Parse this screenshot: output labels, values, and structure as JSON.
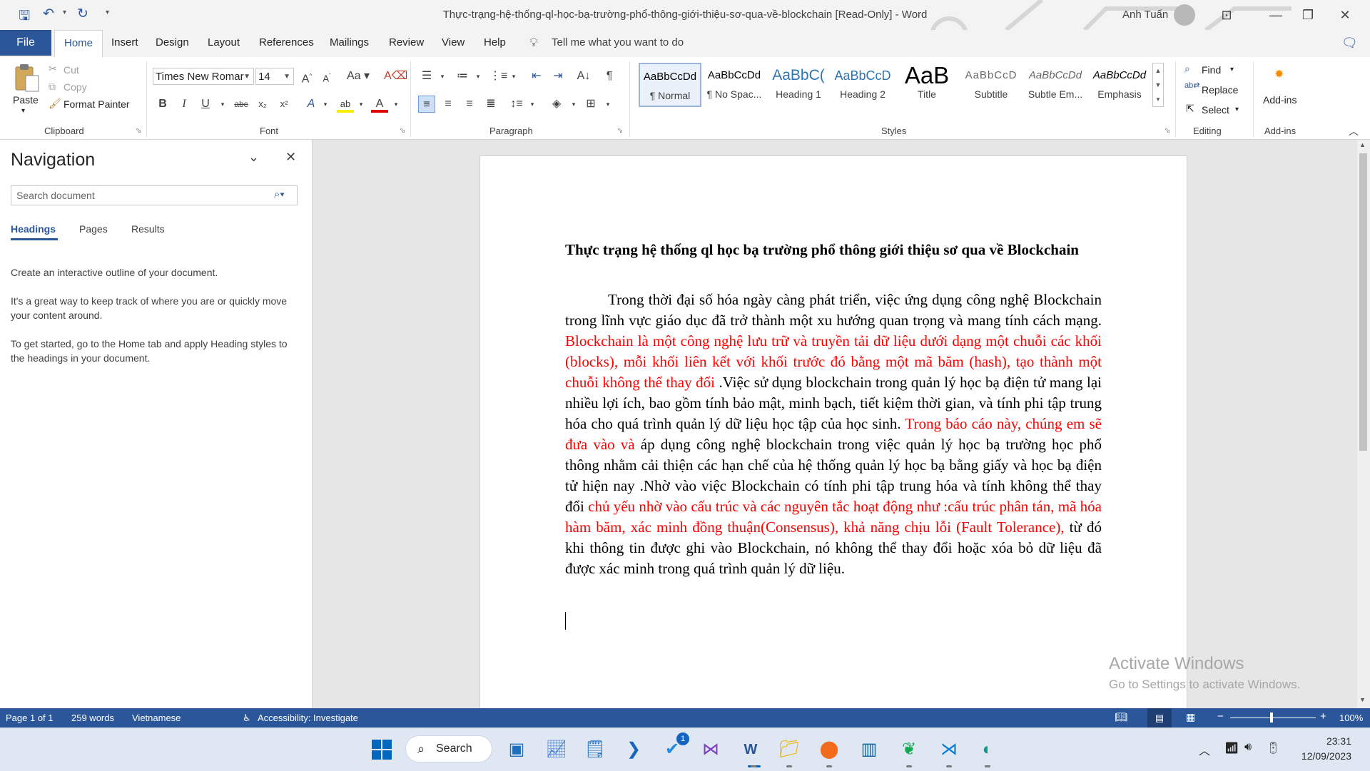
{
  "window": {
    "title": "Thực-trạng-hệ-thống-ql-học-bạ-trường-phổ-thông-giới-thiệu-sơ-qua-về-blockchain [Read-Only]  -  Word",
    "user": "Anh Tuấn"
  },
  "tabs": [
    "File",
    "Home",
    "Insert",
    "Design",
    "Layout",
    "References",
    "Mailings",
    "Review",
    "View",
    "Help"
  ],
  "tell_me": "Tell me what you want to do",
  "ribbon": {
    "clipboard": {
      "paste": "Paste",
      "cut": "Cut",
      "copy": "Copy",
      "format_painter": "Format Painter",
      "label": "Clipboard"
    },
    "font": {
      "name": "Times New Romar",
      "size": "14",
      "label": "Font"
    },
    "paragraph": {
      "label": "Paragraph"
    },
    "styles": {
      "label": "Styles",
      "items": [
        {
          "preview": "AaBbCcDd",
          "name": "¶ Normal"
        },
        {
          "preview": "AaBbCcDd",
          "name": "¶ No Spac..."
        },
        {
          "preview": "AaBbC(",
          "name": "Heading 1"
        },
        {
          "preview": "AaBbCcD",
          "name": "Heading 2"
        },
        {
          "preview": "AaB",
          "name": "Title"
        },
        {
          "preview": "AaBbCcD",
          "name": "Subtitle"
        },
        {
          "preview": "AaBbCcDd",
          "name": "Subtle Em..."
        },
        {
          "preview": "AaBbCcDd",
          "name": "Emphasis"
        }
      ]
    },
    "editing": {
      "find": "Find",
      "replace": "Replace",
      "select": "Select",
      "label": "Editing"
    },
    "addins": {
      "button": "Add-ins",
      "label": "Add-ins"
    }
  },
  "navigation": {
    "title": "Navigation",
    "search_placeholder": "Search document",
    "tabs": [
      "Headings",
      "Pages",
      "Results"
    ],
    "paragraphs": [
      "Create an interactive outline of your document.",
      "It's a great way to keep track of where you are or quickly move your content around.",
      "To get started, go to the Home tab and apply Heading styles to the headings in your document."
    ]
  },
  "document": {
    "heading": "Thực trạng hệ thống ql học bạ trường phổ thông giới thiệu sơ qua về Blockchain",
    "p1": "Trong thời đại số hóa ngày càng phát triển, việc ứng dụng công nghệ Blockchain trong lĩnh vực giáo dục đã trở thành một xu hướng quan trọng và mang tính cách mạng. ",
    "p2_red": "Blockchain là một công nghệ lưu trữ và truyền tải dữ liệu dưới dạng một chuỗi các khối (blocks), mỗi khối liên kết với khối trước đó bằng một mã băm (hash), tạo thành một chuỗi không thể thay đổi",
    "p3": " .Việc sử dụng blockchain trong quản lý học bạ điện tử mang lại nhiều lợi ích, bao gồm tính bảo mật, minh bạch, tiết kiệm thời gian, và tính phi tập trung hóa cho quá trình quản lý dữ liệu học tập của học sinh. ",
    "p4_red": "Trong báo cáo này, chúng em sẽ đưa vào và",
    "p5": " áp dụng công nghệ blockchain trong việc quản lý học bạ trường học phổ thông nhằm cải thiện các hạn chế của hệ thống quản lý học bạ bằng giấy và học bạ điện tử hiện nay .Nhờ vào việc Blockchain có tính phi tập trung hóa và tính không thể thay đổi ",
    "p6_red": "chủ yếu nhờ vào cấu trúc và các nguyên tắc hoạt động như :cấu trúc phân tán, mã hóa hàm băm, xác minh đồng thuận(Consensus), khả năng chịu lỗi (Fault Tolerance),",
    "p7": " từ đó khi thông tin được ghi vào Blockchain, nó không thể thay đổi hoặc xóa bỏ dữ liệu đã được xác minh trong quá trình quản lý dữ liệu."
  },
  "watermark": {
    "line1": "Activate Windows",
    "line2": "Go to Settings to activate Windows."
  },
  "status_bar": {
    "page": "Page 1 of 1",
    "words": "259 words",
    "language": "Vietnamese",
    "accessibility": "Accessibility: Investigate",
    "zoom": "100%"
  },
  "taskbar": {
    "search": "Search",
    "badge": "1",
    "time": "23:31",
    "date": "12/09/2023"
  },
  "colors": {
    "accent": "#2b579a",
    "red_text": "#ff0000"
  }
}
